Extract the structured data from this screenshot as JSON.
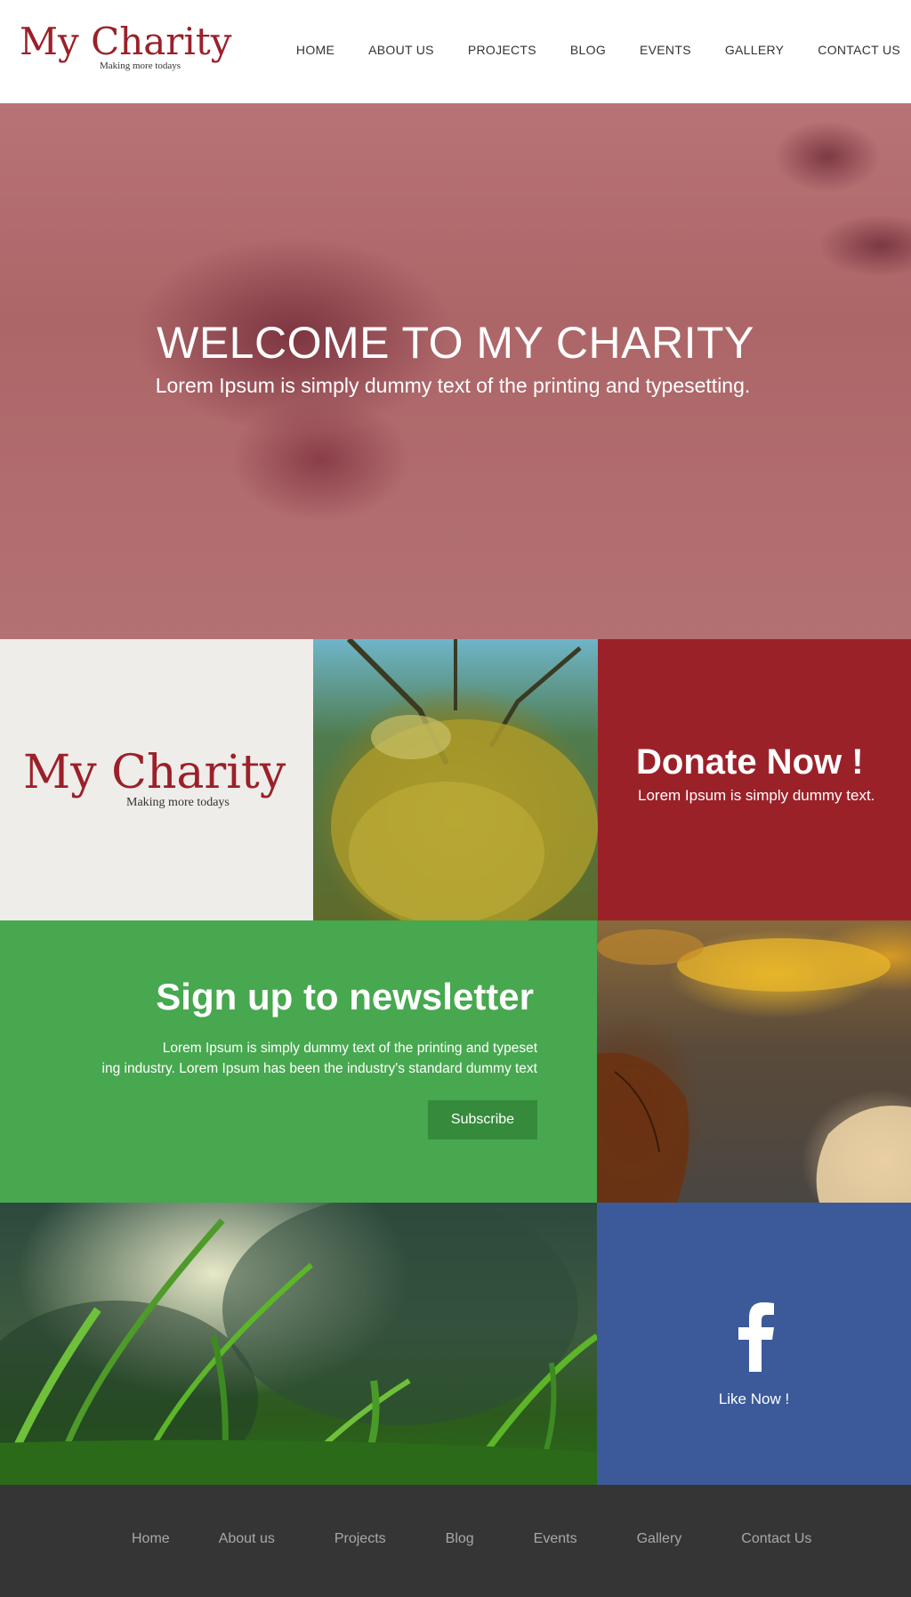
{
  "brand": {
    "name": "My Charity",
    "tagline": "Making more todays",
    "color": "#9b2029"
  },
  "nav": {
    "items": [
      "HOME",
      "ABOUT US",
      "PROJECTS",
      "BLOG",
      "EVENTS",
      "GALLERY",
      "CONTACT US"
    ]
  },
  "hero": {
    "title": "WELCOME TO MY CHARITY",
    "subtitle": "Lorem Ipsum is simply dummy text of the printing and typesetting."
  },
  "donate": {
    "title": "Donate Now !",
    "subtitle": "Lorem Ipsum is simply dummy text.",
    "color": "#9b2129"
  },
  "newsletter": {
    "title": "Sign up to newsletter",
    "text_line1": "Lorem Ipsum is simply dummy text of the printing and typeset",
    "text_line2": "ing industry. Lorem Ipsum has been the industry's standard dummy text",
    "button_label": "Subscribe",
    "color": "#47a84f"
  },
  "facebook": {
    "icon": "facebook-icon",
    "label": "Like Now !",
    "color": "#3c5a99"
  },
  "footer": {
    "items": [
      "Home",
      "About us",
      "Projects",
      "Blog",
      "Events",
      "Gallery",
      "Contact Us"
    ]
  }
}
